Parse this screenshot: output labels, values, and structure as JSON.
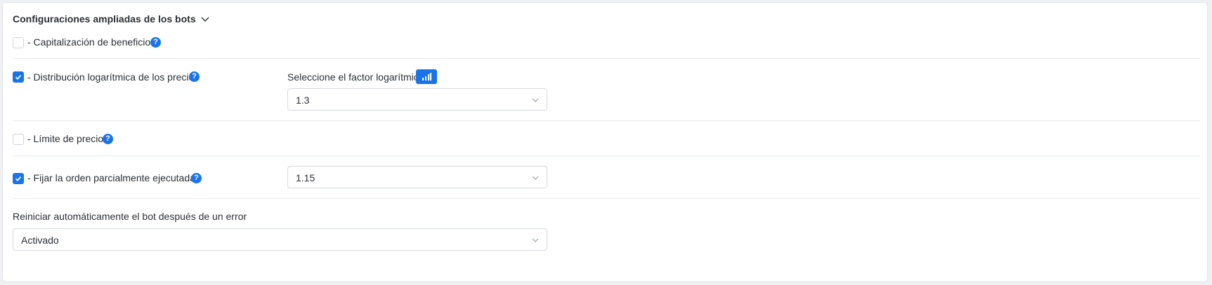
{
  "section": {
    "title": "Configuraciones ampliadas de los bots"
  },
  "options": {
    "profit_capitalization": {
      "label": "- Capitalización de beneficios",
      "checked": false
    },
    "log_distribution": {
      "label": "- Distribución logarítmica de los precios",
      "checked": true
    },
    "price_limit": {
      "label": "- Límite de precio",
      "checked": false
    },
    "fix_partial_orders": {
      "label": "- Fijar la orden parcialmente ejecutadas",
      "checked": true
    }
  },
  "help_icon_glyph": "?",
  "log_factor": {
    "label": "Seleccione el factor logarítmico",
    "value": "1.3"
  },
  "partial_orders_select": {
    "value": "1.15"
  },
  "auto_restart": {
    "label": "Reiniciar automáticamente el bot después de un error",
    "value": "Activado"
  },
  "colors": {
    "accent": "#1a73e8",
    "text": "#2b2f36",
    "border": "#d5d9de"
  }
}
